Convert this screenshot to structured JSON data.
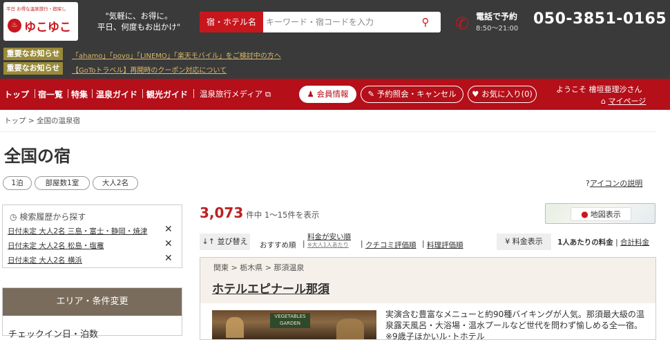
{
  "header": {
    "logo_tagline": "平日 お得な温泉旅行・宿探し",
    "logo_text": "ゆこゆこ",
    "catch_line1": "\"気軽に、お得に。",
    "catch_line2": "平日、何度もお出かけ\"",
    "search_category": "宿・ホテル名",
    "search_placeholder": "キーワード・宿コードを入力",
    "phone_label": "電話で予約",
    "phone_hours": "8:50～21:00",
    "phone_number": "050-3851-0165"
  },
  "notices": [
    {
      "badge": "重要なお知らせ",
      "text": "「ahamo」「povo」「LINEMO」「楽天モバイル」をご検討中の方へ"
    },
    {
      "badge": "重要なお知らせ",
      "text": "【GoToトラベル】再開時のクーポン対応について"
    }
  ],
  "nav": {
    "items": [
      "トップ",
      "宿一覧",
      "特集",
      "温泉ガイド",
      "観光ガイド"
    ],
    "media": "温泉旅行メディア",
    "member": "会員情報",
    "reserve": "予約照会・キャンセル",
    "favorites": "お気に入り(0)",
    "welcome": "ようこそ 檜垣亜理沙さん",
    "mypage": "マイページ"
  },
  "breadcrumb": "トップ > 全国の温泉宿",
  "page_title": "全国の宿",
  "chips": [
    "1泊",
    "部屋数1室",
    "大人2名"
  ],
  "icon_help": "アイコンの説明",
  "history": {
    "title": "検索履歴から探す",
    "items": [
      "日付未定 大人2名 三島・富士・静岡・焼津",
      "日付未定 大人2名 松島・塩竈",
      "日付未定 大人2名 横浜"
    ]
  },
  "area": {
    "header": "エリア・条件変更",
    "sub": "チェックイン日・泊数"
  },
  "results": {
    "count": "3,073",
    "count_text": "件中 1～15件を表示",
    "map_button": "地図表示",
    "sort_button": "↓↑ 並び替え",
    "sort_current": "おすすめ順",
    "sort_cheap": "料金が安い順",
    "sort_cheap_note": "※大人1人あたり",
    "sort_review": "クチコミ評価順",
    "sort_cuisine": "料理評価順",
    "price_button": "料金表示",
    "price_per_person": "1人あたりの料金",
    "price_total": "合計料金"
  },
  "card": {
    "breadcrumb": "関東 > 栃木県 > 那須温泉",
    "name": "ホテルエピナール那須",
    "photo_sign": "VEGETABLES GARDEN",
    "description": "実演含む豊富なメニューと約90種バイキングが人気。那須最大級の温泉露天風呂・大浴場・温水プールなど世代を問わず愉しめる全一宿。※9歳子ほかいル･トホテル"
  },
  "colors": {
    "brand_red": "#c8161d",
    "nav_red": "#b50f1a",
    "header_dark": "#3a3a3a",
    "notice_gold": "#9a8a39",
    "count_red": "#b22222"
  }
}
